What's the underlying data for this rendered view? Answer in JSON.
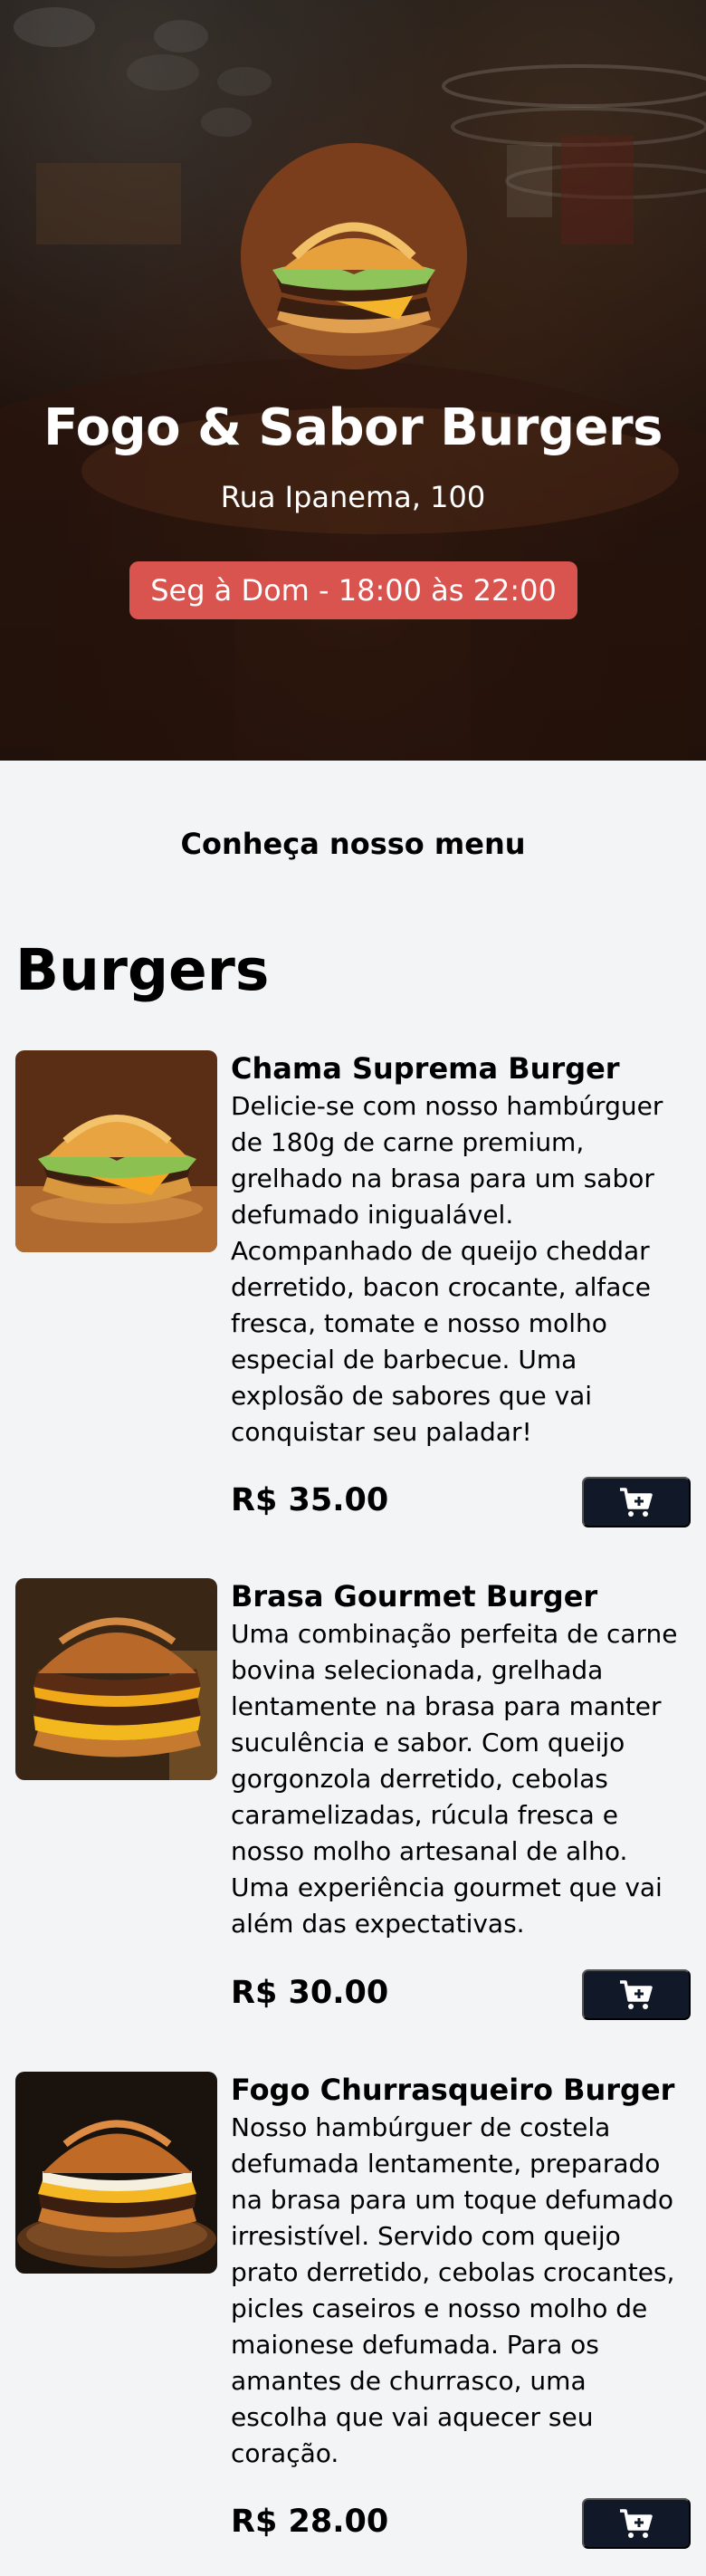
{
  "restaurant": {
    "name": "Fogo & Sabor Burgers",
    "address": "Rua Ipanema, 100",
    "hours": "Seg à Dom - 18:00 às 22:00",
    "accent_color": "#d9534f"
  },
  "menu": {
    "heading": "Conheça nosso menu",
    "category": "Burgers",
    "products": [
      {
        "name": "Chama Suprema Burger",
        "description": "Delicie-se com nosso hambúrguer de 180g de carne premium, grelhado na brasa para um sabor defumado inigualável. Acompanhado de queijo cheddar derretido, bacon crocante, alface fresca, tomate e nosso molho especial de barbecue. Uma explosão de sabores que vai conquistar seu paladar!",
        "price": "R$ 35.00",
        "cart_icon": "add-to-cart-icon"
      },
      {
        "name": "Brasa Gourmet Burger",
        "description": "Uma combinação perfeita de carne bovina selecionada, grelhada lentamente na brasa para manter suculência e sabor. Com queijo gorgonzola derretido, cebolas caramelizadas, rúcula fresca e nosso molho artesanal de alho. Uma experiência gourmet que vai além das expectativas.",
        "price": "R$ 30.00",
        "cart_icon": "add-to-cart-icon"
      },
      {
        "name": "Fogo Churrasqueiro Burger",
        "description": "Nosso hambúrguer de costela defumada lentamente, preparado na brasa para um toque defumado irresistível. Servido com queijo prato derretido, cebolas crocantes, picles caseiros e nosso molho de maionese defumada. Para os amantes de churrasco, uma escolha que vai aquecer seu coração.",
        "price": "R$ 28.00",
        "cart_icon": "add-to-cart-icon"
      }
    ]
  },
  "colors": {
    "page_background": "#f3f4f6",
    "button_background": "#111827"
  }
}
